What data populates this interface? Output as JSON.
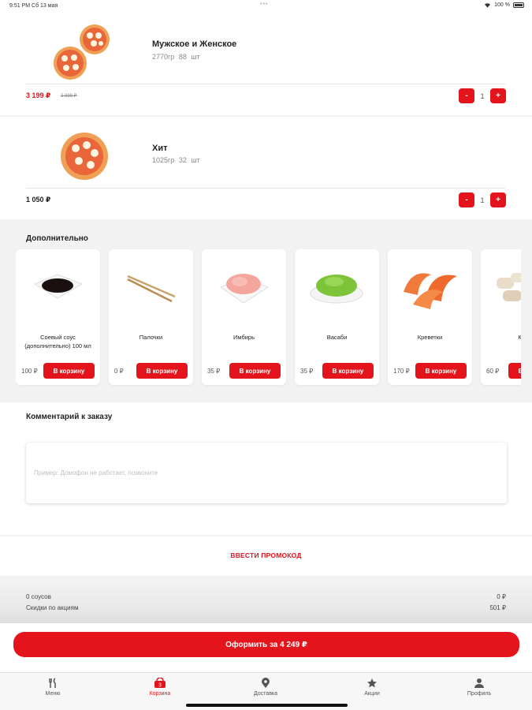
{
  "status_bar": {
    "time_date": "9:51 PM  Сб 13 мая",
    "battery": "100 %"
  },
  "cart_items": [
    {
      "name": "Мужское и Женское",
      "weight": "2770гр",
      "pieces": "88 шт",
      "price": "3 199 ₽",
      "old_price": "3 999 ₽",
      "quantity": "1",
      "minus": "-",
      "plus": "+"
    },
    {
      "name": "Хит",
      "weight": "1025гр",
      "pieces": "32 шт",
      "price": "1 050 ₽",
      "quantity": "1",
      "minus": "-",
      "plus": "+"
    }
  ],
  "additional": {
    "title": "Дополнительно",
    "items": [
      {
        "name": "Соевый соус (дополнительно) 100 мл",
        "price": "100 ₽",
        "button": "В корзину"
      },
      {
        "name": "Палочки",
        "price": "0 ₽",
        "button": "В корзину"
      },
      {
        "name": "Имбирь",
        "price": "35 ₽",
        "button": "В корзину"
      },
      {
        "name": "Васаби",
        "price": "35 ₽",
        "button": "В корзину"
      },
      {
        "name": "Креветки",
        "price": "170 ₽",
        "button": "В корзину"
      },
      {
        "name": "Кур",
        "price": "60 ₽",
        "button": "В корзину"
      }
    ]
  },
  "comment": {
    "title": "Комментарий к заказу",
    "placeholder": "Пример: Домофон не работает, позвоните"
  },
  "promo": {
    "label": "ВВЕСТИ ПРОМОКОД"
  },
  "summary": [
    {
      "label": "0 соусов",
      "value": "0 ₽"
    },
    {
      "label": "Скидки по акциям",
      "value": "501 ₽"
    }
  ],
  "checkout": {
    "label": "Оформить за 4 249 ₽"
  },
  "tabbar": {
    "items": [
      {
        "label": "Меню",
        "icon": "fork-knife-icon"
      },
      {
        "label": "Корзина",
        "icon": "cart-icon",
        "badge": "3"
      },
      {
        "label": "Доставка",
        "icon": "location-pin-icon"
      },
      {
        "label": "Акции",
        "icon": "star-icon"
      },
      {
        "label": "Профиль",
        "icon": "person-icon"
      }
    ],
    "active": "Корзина"
  },
  "colors": {
    "accent": "#e3141b",
    "background": "#f2f2f2",
    "card": "#ffffff"
  }
}
